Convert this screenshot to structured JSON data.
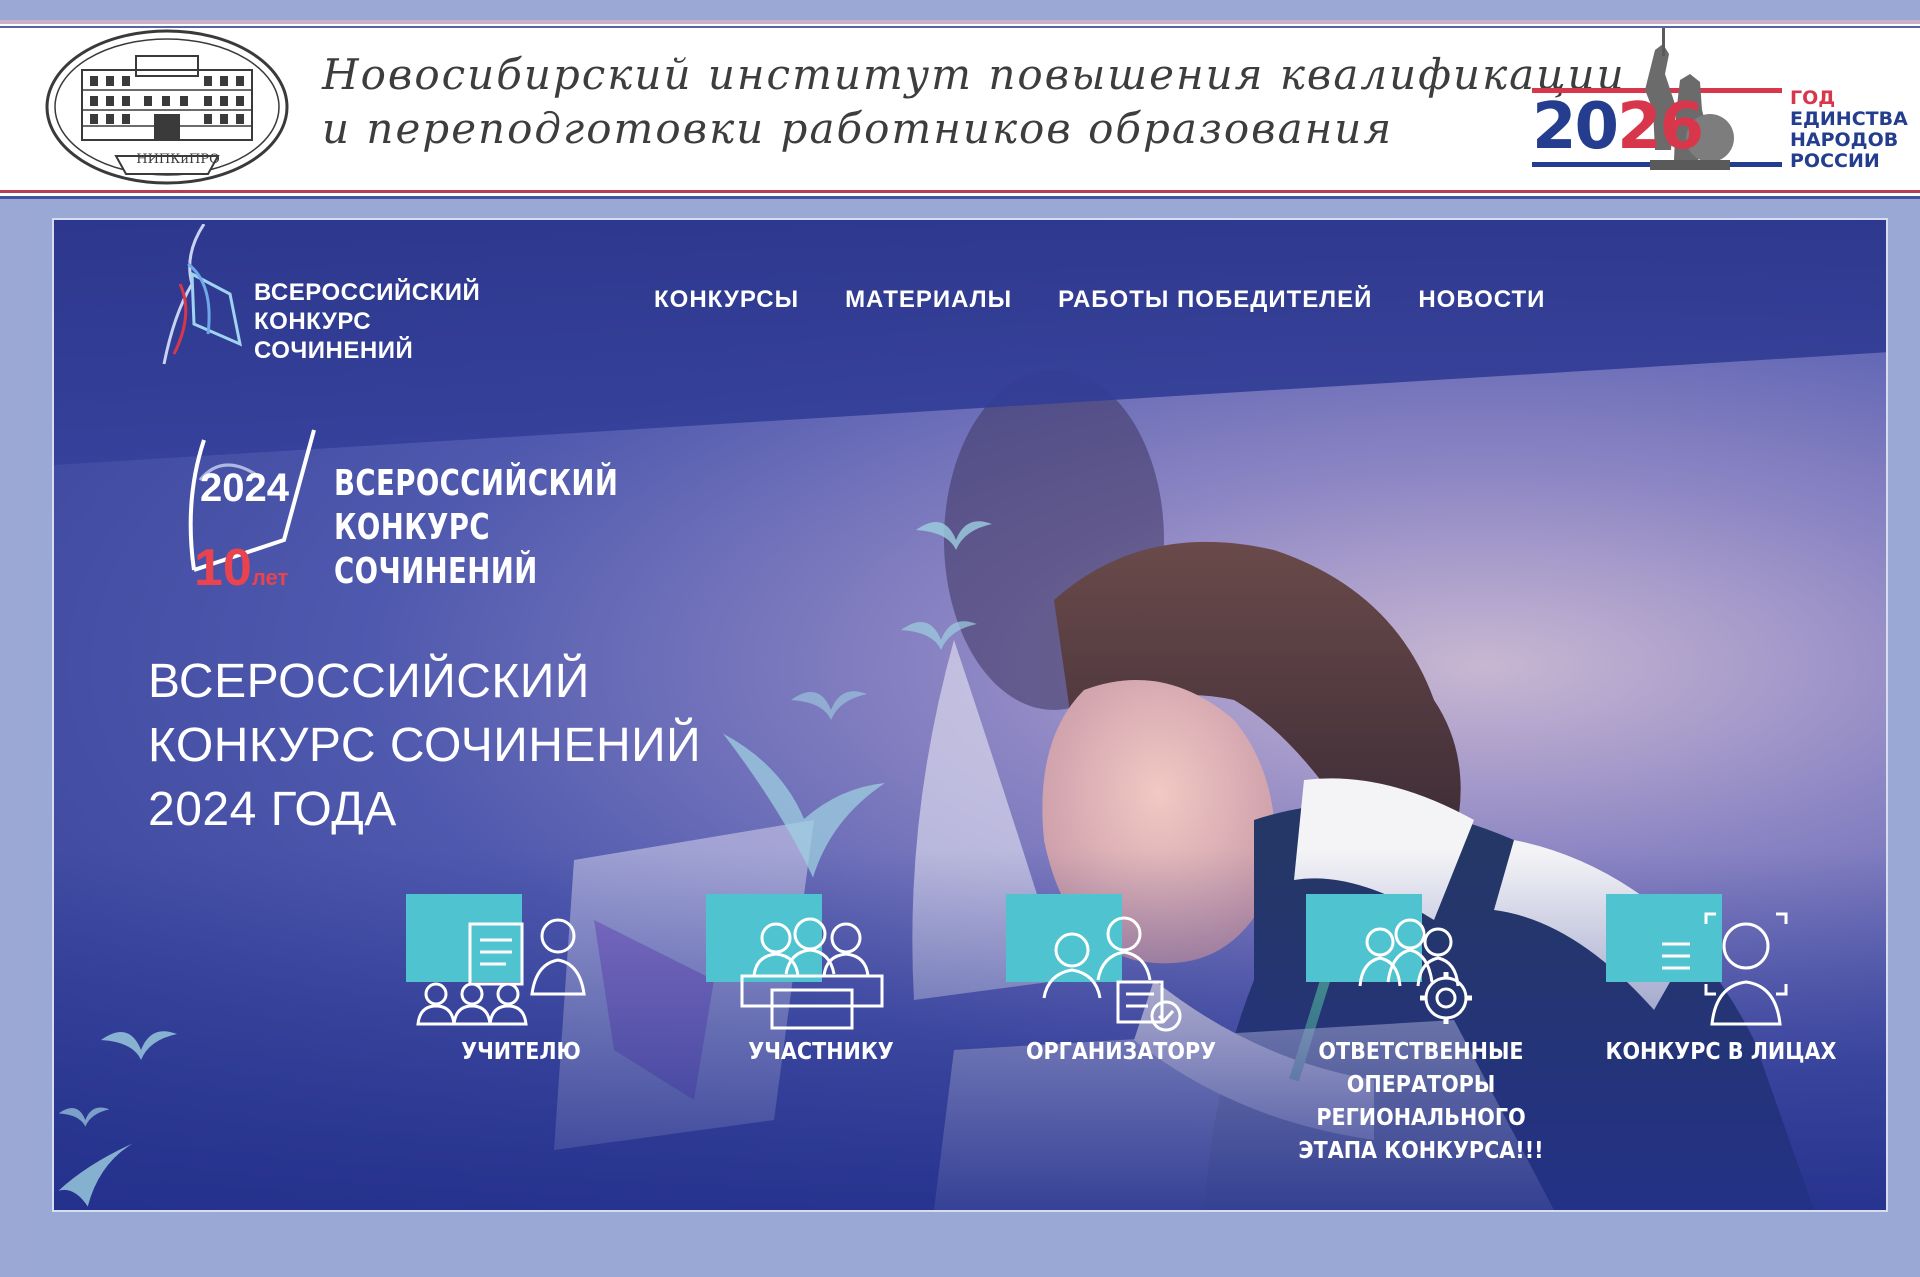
{
  "header": {
    "institute_line1": "Новосибирский институт повышения квалификации",
    "institute_line2": "и переподготовки работников образования",
    "seal_label": "НИПКиПРО",
    "year_badge": {
      "year_prefix": "20",
      "year_accent": "26",
      "lines": [
        "ГОД",
        "ЕДИНСТВА",
        "НАРОДОВ",
        "РОССИИ"
      ]
    }
  },
  "banner": {
    "brand_lines": [
      "ВСЕРОССИЙСКИЙ",
      "КОНКУРС",
      "СОЧИНЕНИЙ"
    ],
    "nav": [
      "КОНКУРСЫ",
      "МАТЕРИАЛЫ",
      "РАБОТЫ ПОБЕДИТЕЛЕЙ",
      "НОВОСТИ"
    ],
    "anniversary_logo": {
      "year": "2024",
      "ten": "10",
      "let": "лет",
      "lines": [
        "ВСЕРОССИЙСКИЙ",
        "КОНКУРС",
        "СОЧИНЕНИЙ"
      ]
    },
    "headline": [
      "ВСЕРОССИЙСКИЙ",
      "КОНКУРС СОЧИНЕНИЙ",
      "2024 ГОДА"
    ],
    "cards": [
      {
        "label": [
          "УЧИТЕЛЮ"
        ],
        "icon": "teacher-icon"
      },
      {
        "label": [
          "УЧАСТНИКУ"
        ],
        "icon": "participant-icon"
      },
      {
        "label": [
          "ОРГАНИЗАТОРУ"
        ],
        "icon": "organizer-icon"
      },
      {
        "label": [
          "ОТВЕТСТВЕННЫЕ",
          "ОПЕРАТОРЫ",
          "РЕГИОНАЛЬНОГО",
          "ЭТАПА КОНКУРСА!!!"
        ],
        "icon": "operators-icon"
      },
      {
        "label": [
          "КОНКУРС В ЛИЦАХ"
        ],
        "icon": "faces-icon"
      }
    ]
  },
  "colors": {
    "page_bg": "#9aa8d5",
    "banner_dark": "#2c368c",
    "accent_teal": "#4fc3cf",
    "accent_red": "#d8374b",
    "accent_blue": "#243d8e"
  }
}
